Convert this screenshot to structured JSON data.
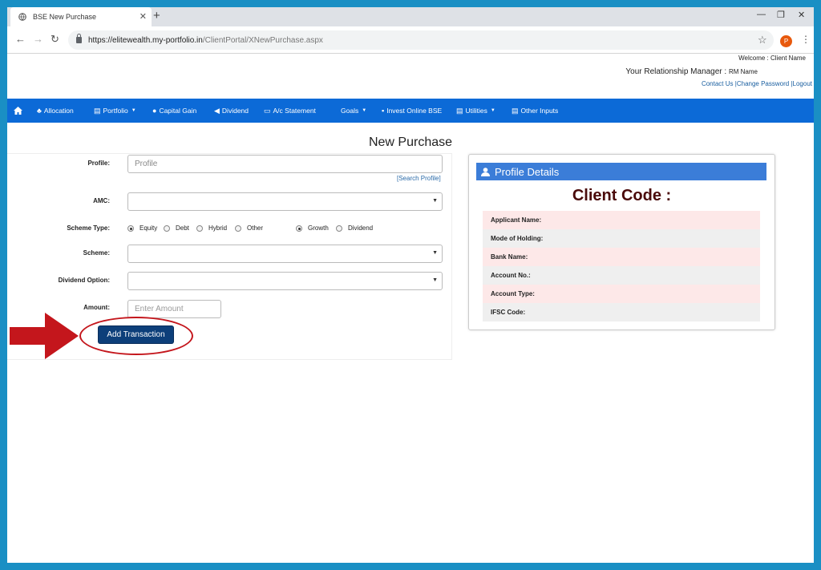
{
  "browser": {
    "tab_title": "BSE New Purchase",
    "tab_close": "✕",
    "new_tab": "+",
    "url_host": "https://elitewealth.my-portfolio.in",
    "url_path": "/ClientPortal/XNewPurchase.aspx",
    "profile_initial": "P",
    "win_minimize": "—",
    "win_restore": "❐",
    "win_close": "✕"
  },
  "header": {
    "welcome": "Welcome :",
    "client_name": "Client Name",
    "rm_label": "Your Relationship Manager :",
    "rm_name": "RM Name",
    "contact": "Contact Us",
    "change_password": "|Change Password",
    "logout": "|Logout"
  },
  "nav": {
    "items": [
      {
        "label": "Allocation",
        "icon": "users-icon"
      },
      {
        "label": "Portfolio",
        "icon": "table-icon"
      },
      {
        "label": "Capital Gain",
        "icon": "comments-icon"
      },
      {
        "label": "Dividend",
        "icon": "bullhorn-icon"
      },
      {
        "label": "A/c Statement",
        "icon": "file-icon"
      },
      {
        "label": "Goals",
        "icon": ""
      },
      {
        "label": "Invest Online BSE",
        "icon": "lock-icon"
      },
      {
        "label": "Utilities",
        "icon": "table-icon"
      },
      {
        "label": "Other Inputs",
        "icon": "table-icon"
      }
    ]
  },
  "page": {
    "title": "New Purchase"
  },
  "form": {
    "profile_label": "Profile:",
    "profile_placeholder": "Profile",
    "search_profile": "[Search Profile]",
    "amc_label": "AMC:",
    "scheme_type_label": "Scheme Type:",
    "scheme_types": [
      "Equity",
      "Debt",
      "Hybrid",
      "Other"
    ],
    "plan_types": [
      "Growth",
      "Dividend"
    ],
    "scheme_label": "Scheme:",
    "dividend_option_label": "Dividend Option:",
    "amount_label": "Amount:",
    "amount_placeholder": "Enter Amount",
    "add_button": "Add Transaction"
  },
  "profile_details": {
    "heading": "Profile Details",
    "client_code": "Client Code :",
    "rows": [
      "Applicant Name:",
      "Mode of Holding:",
      "Bank Name:",
      "Account No.:",
      "Account Type:",
      "IFSC Code:"
    ]
  },
  "colors": {
    "nav": "#0c6ad7",
    "button": "#0d3f7a",
    "annotation": "#c4161c",
    "frame": "#1a8fc4"
  }
}
